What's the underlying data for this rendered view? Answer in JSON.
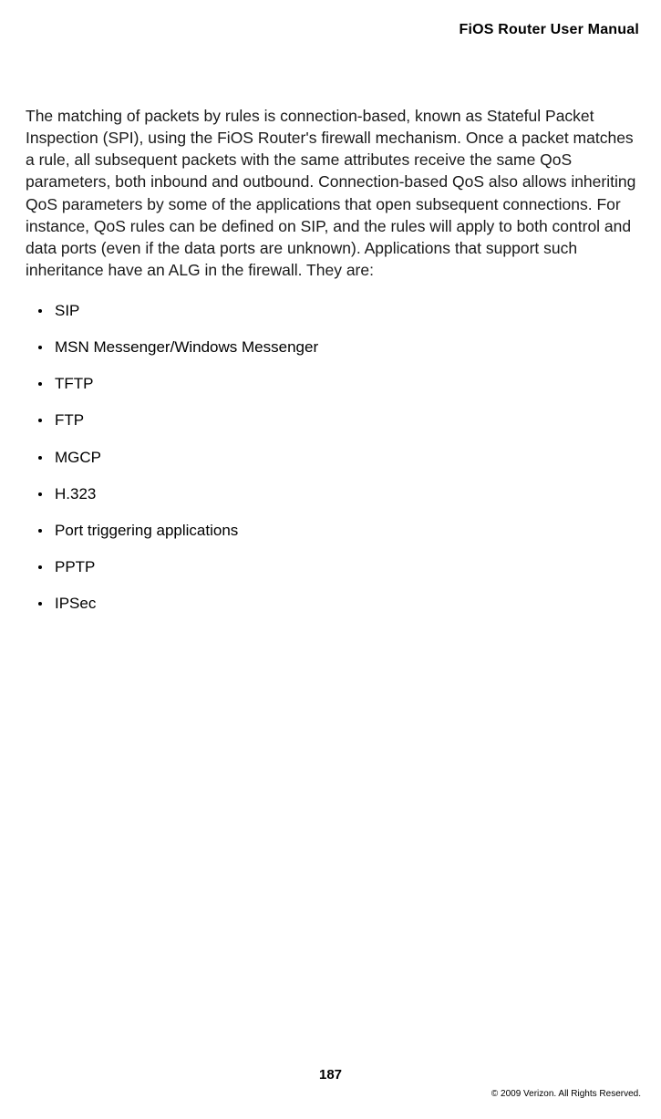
{
  "header": {
    "title": "FiOS Router User Manual"
  },
  "content": {
    "paragraph": "The matching of packets by rules is connection-based, known as Stateful Packet Inspection (SPI), using the FiOS Router's firewall mechanism. Once a packet matches a rule, all subsequent packets with the same attributes receive the same QoS parameters, both inbound and outbound. Connection-based QoS also allows inheriting QoS parameters by some of the applications that open subsequent connections. For instance, QoS rules can be defined on SIP, and the rules will apply to both control and data ports (even if the data ports are unknown). Applications that support such inheritance have an ALG in the firewall. They are:",
    "bullets": [
      "SIP",
      "MSN Messenger/Windows Messenger",
      "TFTP",
      "FTP",
      "MGCP",
      "H.323",
      "Port triggering applications",
      "PPTP",
      "IPSec"
    ]
  },
  "footer": {
    "page_number": "187",
    "copyright": "© 2009 Verizon. All Rights Reserved."
  }
}
